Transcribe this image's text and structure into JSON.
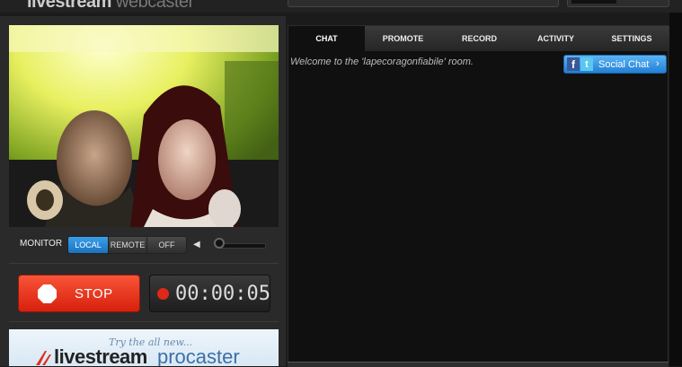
{
  "app": {
    "brand_main": "livestream",
    "brand_sub": "webcaster"
  },
  "monitor": {
    "label": "MONITOR",
    "options": [
      "LOCAL",
      "REMOTE",
      "OFF"
    ],
    "selected": "LOCAL",
    "volume_fraction": 0.05
  },
  "broadcast": {
    "stop_label": "STOP",
    "timer": "00:00:05"
  },
  "promo": {
    "tagline": "Try the all new...",
    "brand": "livestream",
    "product": "procaster"
  },
  "tabs": [
    {
      "label": "CHAT",
      "active": true
    },
    {
      "label": "PROMOTE",
      "active": false
    },
    {
      "label": "RECORD",
      "active": false
    },
    {
      "label": "ACTIVITY",
      "active": false
    },
    {
      "label": "SETTINGS",
      "active": false
    }
  ],
  "chat": {
    "welcome": "Welcome to the 'lapecoragonfiabile' room.",
    "social_button": "Social Chat"
  },
  "icons": {
    "stop": "stop-octagon-icon",
    "record": "record-dot-icon",
    "speaker": "speaker-icon",
    "facebook": "facebook-icon",
    "twitter": "twitter-icon"
  },
  "colors": {
    "accent_blue": "#1a72c0",
    "stop_red": "#d8200c",
    "record_red": "#e02818"
  }
}
